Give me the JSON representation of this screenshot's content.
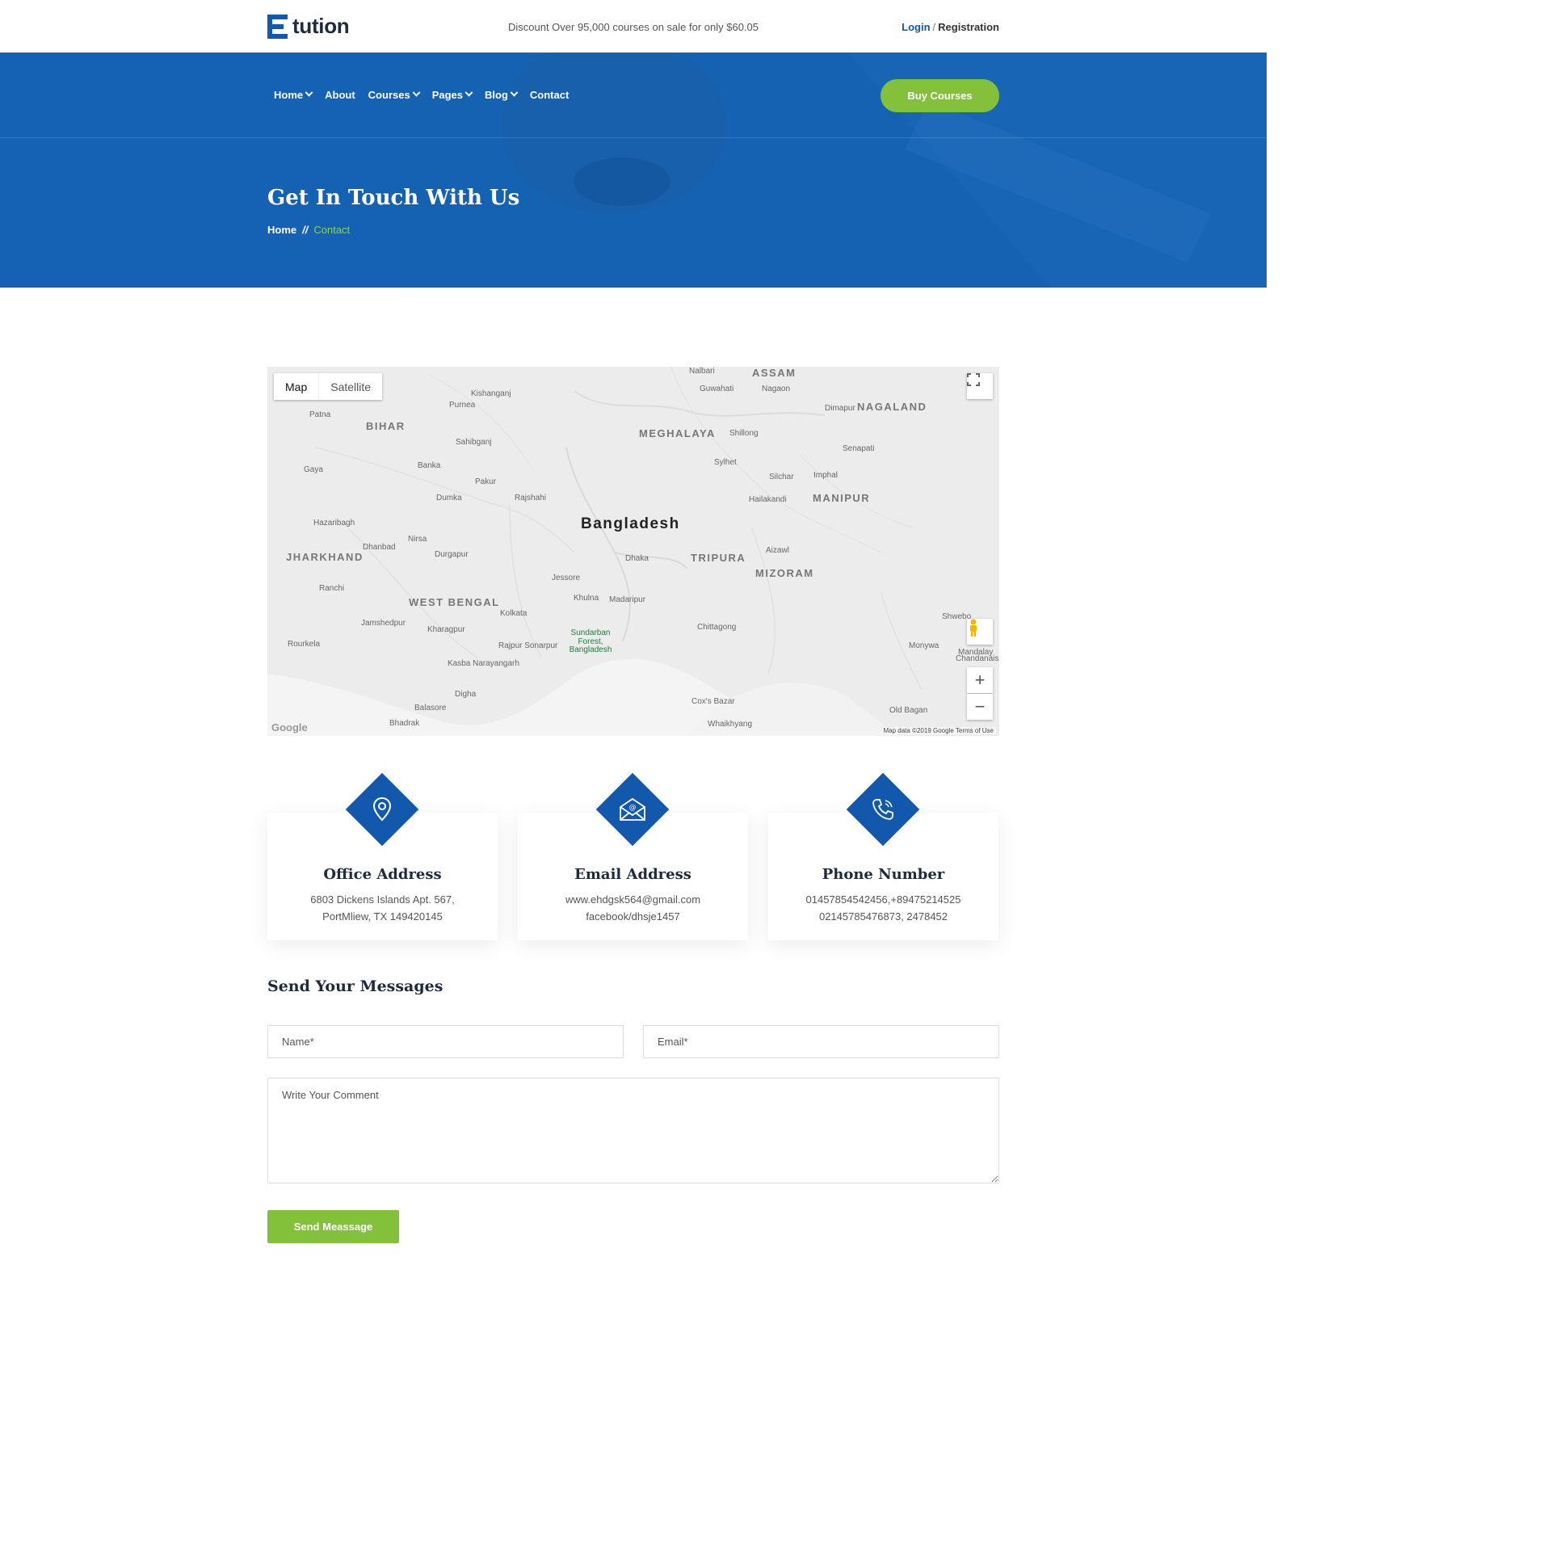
{
  "header": {
    "logo_text": "tution",
    "promo": "Discount Over 95,000 courses on sale for only $60.05",
    "login": "Login",
    "separator": "/",
    "registration": "Registration"
  },
  "nav": {
    "items": [
      {
        "label": "Home",
        "dropdown": true
      },
      {
        "label": "About",
        "dropdown": false
      },
      {
        "label": "Courses",
        "dropdown": true
      },
      {
        "label": "Pages",
        "dropdown": true
      },
      {
        "label": "Blog",
        "dropdown": true
      },
      {
        "label": "Contact",
        "dropdown": false
      }
    ],
    "cta": "Buy Courses"
  },
  "hero": {
    "title": "Get In Touch With Us",
    "breadcrumb_home": "Home",
    "breadcrumb_sep": "//",
    "breadcrumb_current": "Contact"
  },
  "map": {
    "toggle_map": "Map",
    "toggle_satellite": "Satellite",
    "credit": "Map data ©2019 Google   Terms of Use",
    "google": "Google",
    "labels": [
      {
        "text": "ASSAM",
        "kind": "region"
      },
      {
        "text": "Nalbari",
        "kind": "town"
      },
      {
        "text": "Guwahati",
        "kind": "town"
      },
      {
        "text": "Nagaon",
        "kind": "town"
      },
      {
        "text": "NAGALAND",
        "kind": "region"
      },
      {
        "text": "Dimapur",
        "kind": "town"
      },
      {
        "text": "Kishanganj",
        "kind": "town"
      },
      {
        "text": "Purnea",
        "kind": "town"
      },
      {
        "text": "Patna",
        "kind": "town"
      },
      {
        "text": "BIHAR",
        "kind": "region"
      },
      {
        "text": "MEGHALAYA",
        "kind": "region"
      },
      {
        "text": "Shillong",
        "kind": "town"
      },
      {
        "text": "Sahibganj",
        "kind": "town"
      },
      {
        "text": "Senapati",
        "kind": "town"
      },
      {
        "text": "Gaya",
        "kind": "town"
      },
      {
        "text": "Banka",
        "kind": "town"
      },
      {
        "text": "Sylhet",
        "kind": "town"
      },
      {
        "text": "Silchar",
        "kind": "town"
      },
      {
        "text": "Imphal",
        "kind": "town"
      },
      {
        "text": "Pakur",
        "kind": "town"
      },
      {
        "text": "Rajshahi",
        "kind": "town"
      },
      {
        "text": "Dumka",
        "kind": "town"
      },
      {
        "text": "Hailakandi",
        "kind": "town"
      },
      {
        "text": "MANIPUR",
        "kind": "region"
      },
      {
        "text": "Hazaribagh",
        "kind": "town"
      },
      {
        "text": "Bangladesh",
        "kind": "country"
      },
      {
        "text": "Nirsa",
        "kind": "town"
      },
      {
        "text": "Dhanbad",
        "kind": "town"
      },
      {
        "text": "JHARKHAND",
        "kind": "region"
      },
      {
        "text": "Durgapur",
        "kind": "town"
      },
      {
        "text": "Dhaka",
        "kind": "town"
      },
      {
        "text": "TRIPURA",
        "kind": "region"
      },
      {
        "text": "Aizawl",
        "kind": "town"
      },
      {
        "text": "MIZORAM",
        "kind": "region"
      },
      {
        "text": "Ranchi",
        "kind": "town"
      },
      {
        "text": "Jessore",
        "kind": "town"
      },
      {
        "text": "WEST BENGAL",
        "kind": "region"
      },
      {
        "text": "Khulna",
        "kind": "town"
      },
      {
        "text": "Madaripur",
        "kind": "town"
      },
      {
        "text": "Kolkata",
        "kind": "town"
      },
      {
        "text": "Jamshedpur",
        "kind": "town"
      },
      {
        "text": "Kharagpur",
        "kind": "town"
      },
      {
        "text": "Chittagong",
        "kind": "town"
      },
      {
        "text": "Sundarban Forest, Bangladesh",
        "kind": "park"
      },
      {
        "text": "Rourkela",
        "kind": "town"
      },
      {
        "text": "Rajpur Sonarpur",
        "kind": "town"
      },
      {
        "text": "Monywa",
        "kind": "town"
      },
      {
        "text": "Mandalay",
        "kind": "town"
      },
      {
        "text": "Shwebo",
        "kind": "town"
      },
      {
        "text": "Chandanaish",
        "kind": "town"
      },
      {
        "text": "Kasba Narayangarh",
        "kind": "town"
      },
      {
        "text": "Digha",
        "kind": "town"
      },
      {
        "text": "Balasore",
        "kind": "town"
      },
      {
        "text": "Cox's Bazar",
        "kind": "town"
      },
      {
        "text": "Bhadrak",
        "kind": "town"
      },
      {
        "text": "Old Bagan",
        "kind": "town"
      },
      {
        "text": "Whaikhyang",
        "kind": "town"
      }
    ]
  },
  "cards": [
    {
      "title": "Office Address",
      "line1": "6803 Dickens Islands Apt. 567,",
      "line2": "PortMliew, TX 149420145",
      "icon": "location-pin-icon"
    },
    {
      "title": "Email Address",
      "line1": "www.ehdgsk564@gmail.com",
      "line2": "facebook/dhsje1457",
      "icon": "envelope-icon"
    },
    {
      "title": "Phone Number",
      "line1": "01457854542456,+89475214525",
      "line2": "02145785476873, 2478452",
      "icon": "phone-icon"
    }
  ],
  "form": {
    "title": "Send Your Messages",
    "name_placeholder": "Name*",
    "email_placeholder": "Email*",
    "comment_placeholder": "Write Your Comment",
    "submit": "Send Meassage"
  },
  "colors": {
    "primary_blue": "#1258ad",
    "hero_blue": "#1562b3",
    "accent_green": "#84c13b",
    "breadcrumb_green": "#8fd14f"
  }
}
